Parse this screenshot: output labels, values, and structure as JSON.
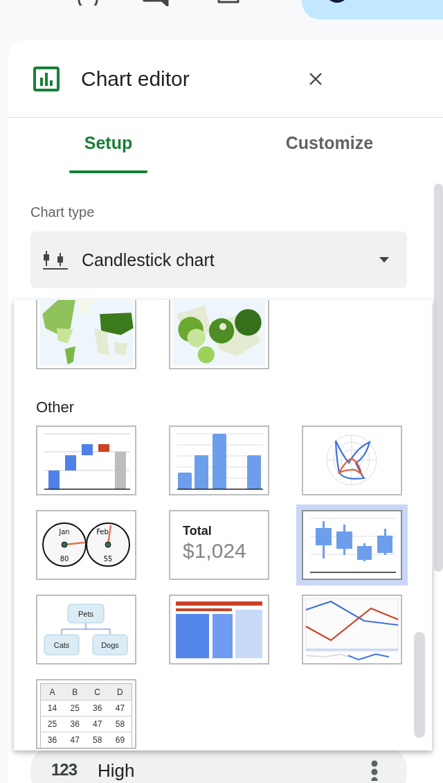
{
  "editor": {
    "title": "Chart editor"
  },
  "tabs": [
    {
      "label": "Setup",
      "selected": true
    },
    {
      "label": "Customize",
      "selected": false
    }
  ],
  "chart_type": {
    "label": "Chart type",
    "value": "Candlestick chart"
  },
  "chart_menu": {
    "sections": [
      {
        "thumbnails": [
          {
            "kind": "geo",
            "selected": false
          },
          {
            "kind": "geo_bubble",
            "selected": false
          }
        ]
      },
      {
        "heading": "Other",
        "thumbnails": [
          {
            "kind": "waterfall",
            "selected": false
          },
          {
            "kind": "column",
            "selected": false
          },
          {
            "kind": "radar",
            "selected": false
          },
          {
            "kind": "gauge",
            "selected": false,
            "gauges": [
              {
                "name": "Jan",
                "value": "80"
              },
              {
                "name": "Feb",
                "value": "55"
              }
            ]
          },
          {
            "kind": "scorecard",
            "selected": false,
            "title": "Total",
            "value": "$1,024"
          },
          {
            "kind": "candlestick",
            "selected": true
          },
          {
            "kind": "org",
            "selected": false,
            "root": "Pets",
            "children": [
              "Cats",
              "Dogs"
            ]
          },
          {
            "kind": "treemap",
            "selected": false
          },
          {
            "kind": "timeline",
            "selected": false
          },
          {
            "kind": "table",
            "selected": false,
            "columns": [
              "A",
              "B",
              "C",
              "D"
            ],
            "rows": [
              [
                "14",
                "25",
                "36",
                "47"
              ],
              [
                "25",
                "36",
                "47",
                "58"
              ],
              [
                "36",
                "47",
                "58",
                "69"
              ]
            ]
          }
        ]
      }
    ]
  },
  "series": [
    {
      "type_icon": "123",
      "label": "High"
    }
  ]
}
